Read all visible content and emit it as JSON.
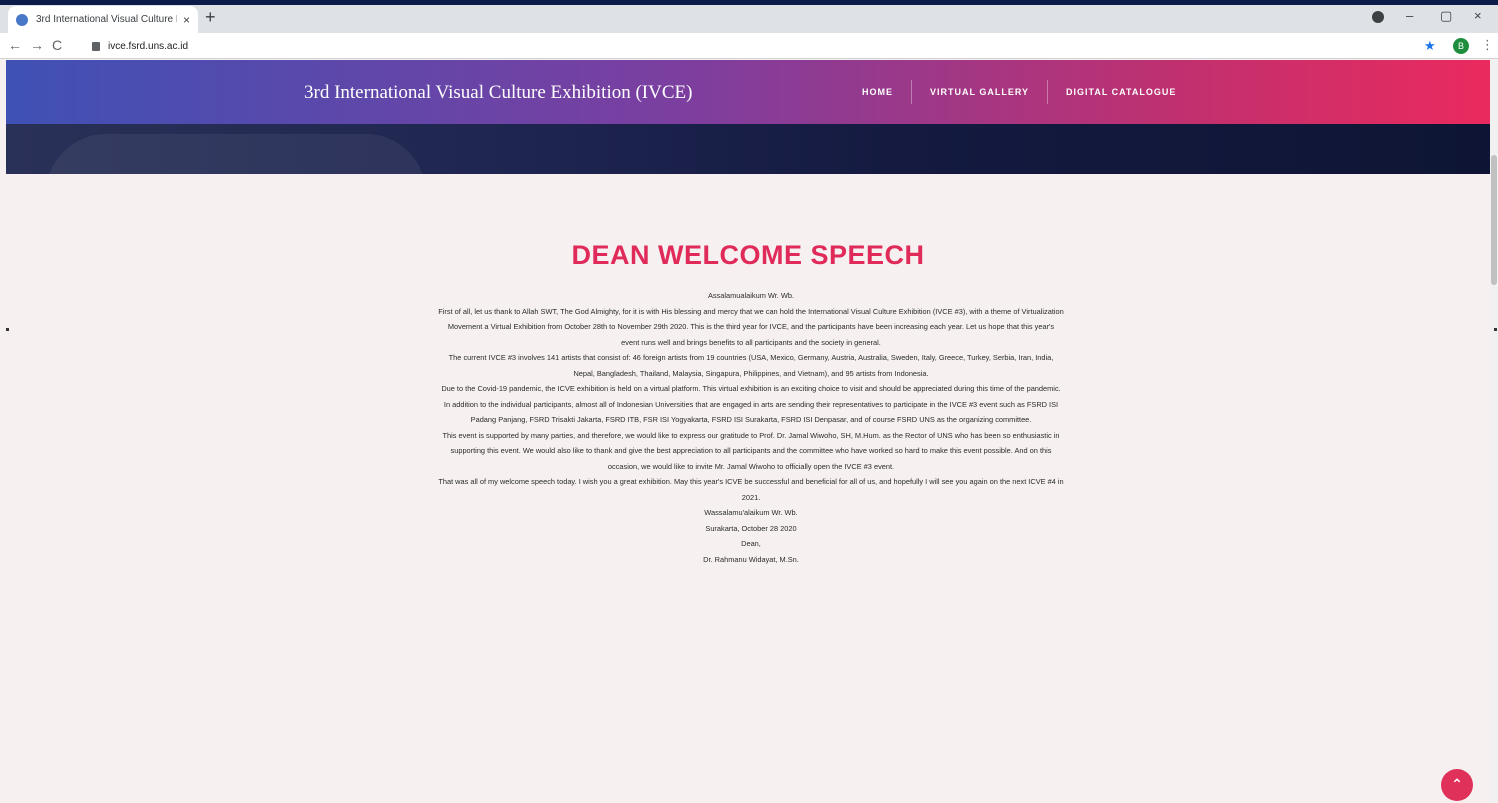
{
  "browser": {
    "tab_title": "3rd International Visual Culture E",
    "tab_close": "×",
    "new_tab": "+",
    "url": "ivce.fsrd.uns.ac.id",
    "back": "←",
    "forward": "→",
    "reload": "C",
    "star": "★",
    "profile_initial": "B",
    "menu_dots": "⋮",
    "minimize": "–",
    "maximize": "▢",
    "close": "×"
  },
  "site": {
    "title": "3rd International Visual Culture Exhibition (IVCE)",
    "menu": [
      "HOME",
      "VIRTUAL GALLERY",
      "DIGITAL CATALOGUE"
    ]
  },
  "speech": {
    "heading": "DEAN WELCOME SPEECH",
    "paragraphs": [
      "Assalamualaikum Wr. Wb.",
      "First of all, let us thank to Allah SWT, The God Almighty, for it is with His blessing and mercy that we can hold the International Visual Culture Exhibition (IVCE #3), with a theme of Virtualization Movement a Virtual Exhibition from October 28th to November 29th 2020. This is the third year for IVCE, and the participants have been increasing each year. Let us hope that this year's event runs well and brings benefits to all participants and the society in general.",
      "The current IVCE #3 involves 141 artists that consist of: 46 foreign artists from 19 countries (USA, Mexico, Germany, Austria, Australia, Sweden, Italy, Greece, Turkey, Serbia, Iran, India, Nepal, Bangladesh, Thailand, Malaysia, Singapura, Philippines, and Vietnam), and 95 artists from Indonesia.",
      "Due to the Covid-19 pandemic, the ICVE exhibition is held on a virtual platform. This virtual exhibition is an exciting choice to visit and should be appreciated during this time of the pandemic. In addition to the individual participants, almost all of Indonesian Universities that are engaged in arts are sending their representatives to participate in the IVCE #3 event such as FSRD ISI Padang Panjang, FSRD Trisakti Jakarta, FSRD ITB, FSR ISI Yogyakarta, FSRD ISI Surakarta, FSRD ISI Denpasar, and of course FSRD UNS as the organizing committee.",
      "This event is supported by many parties, and therefore, we would like to express our gratitude to Prof. Dr. Jamal Wiwoho, SH, M.Hum. as the Rector of UNS who has been so enthusiastic in supporting this event. We would also like to thank and give the best appreciation to all participants and the committee who have worked so hard to make this event possible. And on this occasion, we would like to invite Mr. Jamal Wiwoho to officially open the IVCE #3 event.",
      "That was all of my welcome speech today. I wish you a great exhibition. May this year's ICVE be successful and beneficial for all of us, and hopefully I will see you again on the next ICVE #4 in 2021."
    ],
    "closing": "Wassalamu'alaikum Wr. Wb.",
    "place_date": "Surakarta, October 28 2020",
    "role": "Dean,",
    "signatory": "Dr. Rahmanu Widayat, M.Sn."
  },
  "to_top": "⌃"
}
